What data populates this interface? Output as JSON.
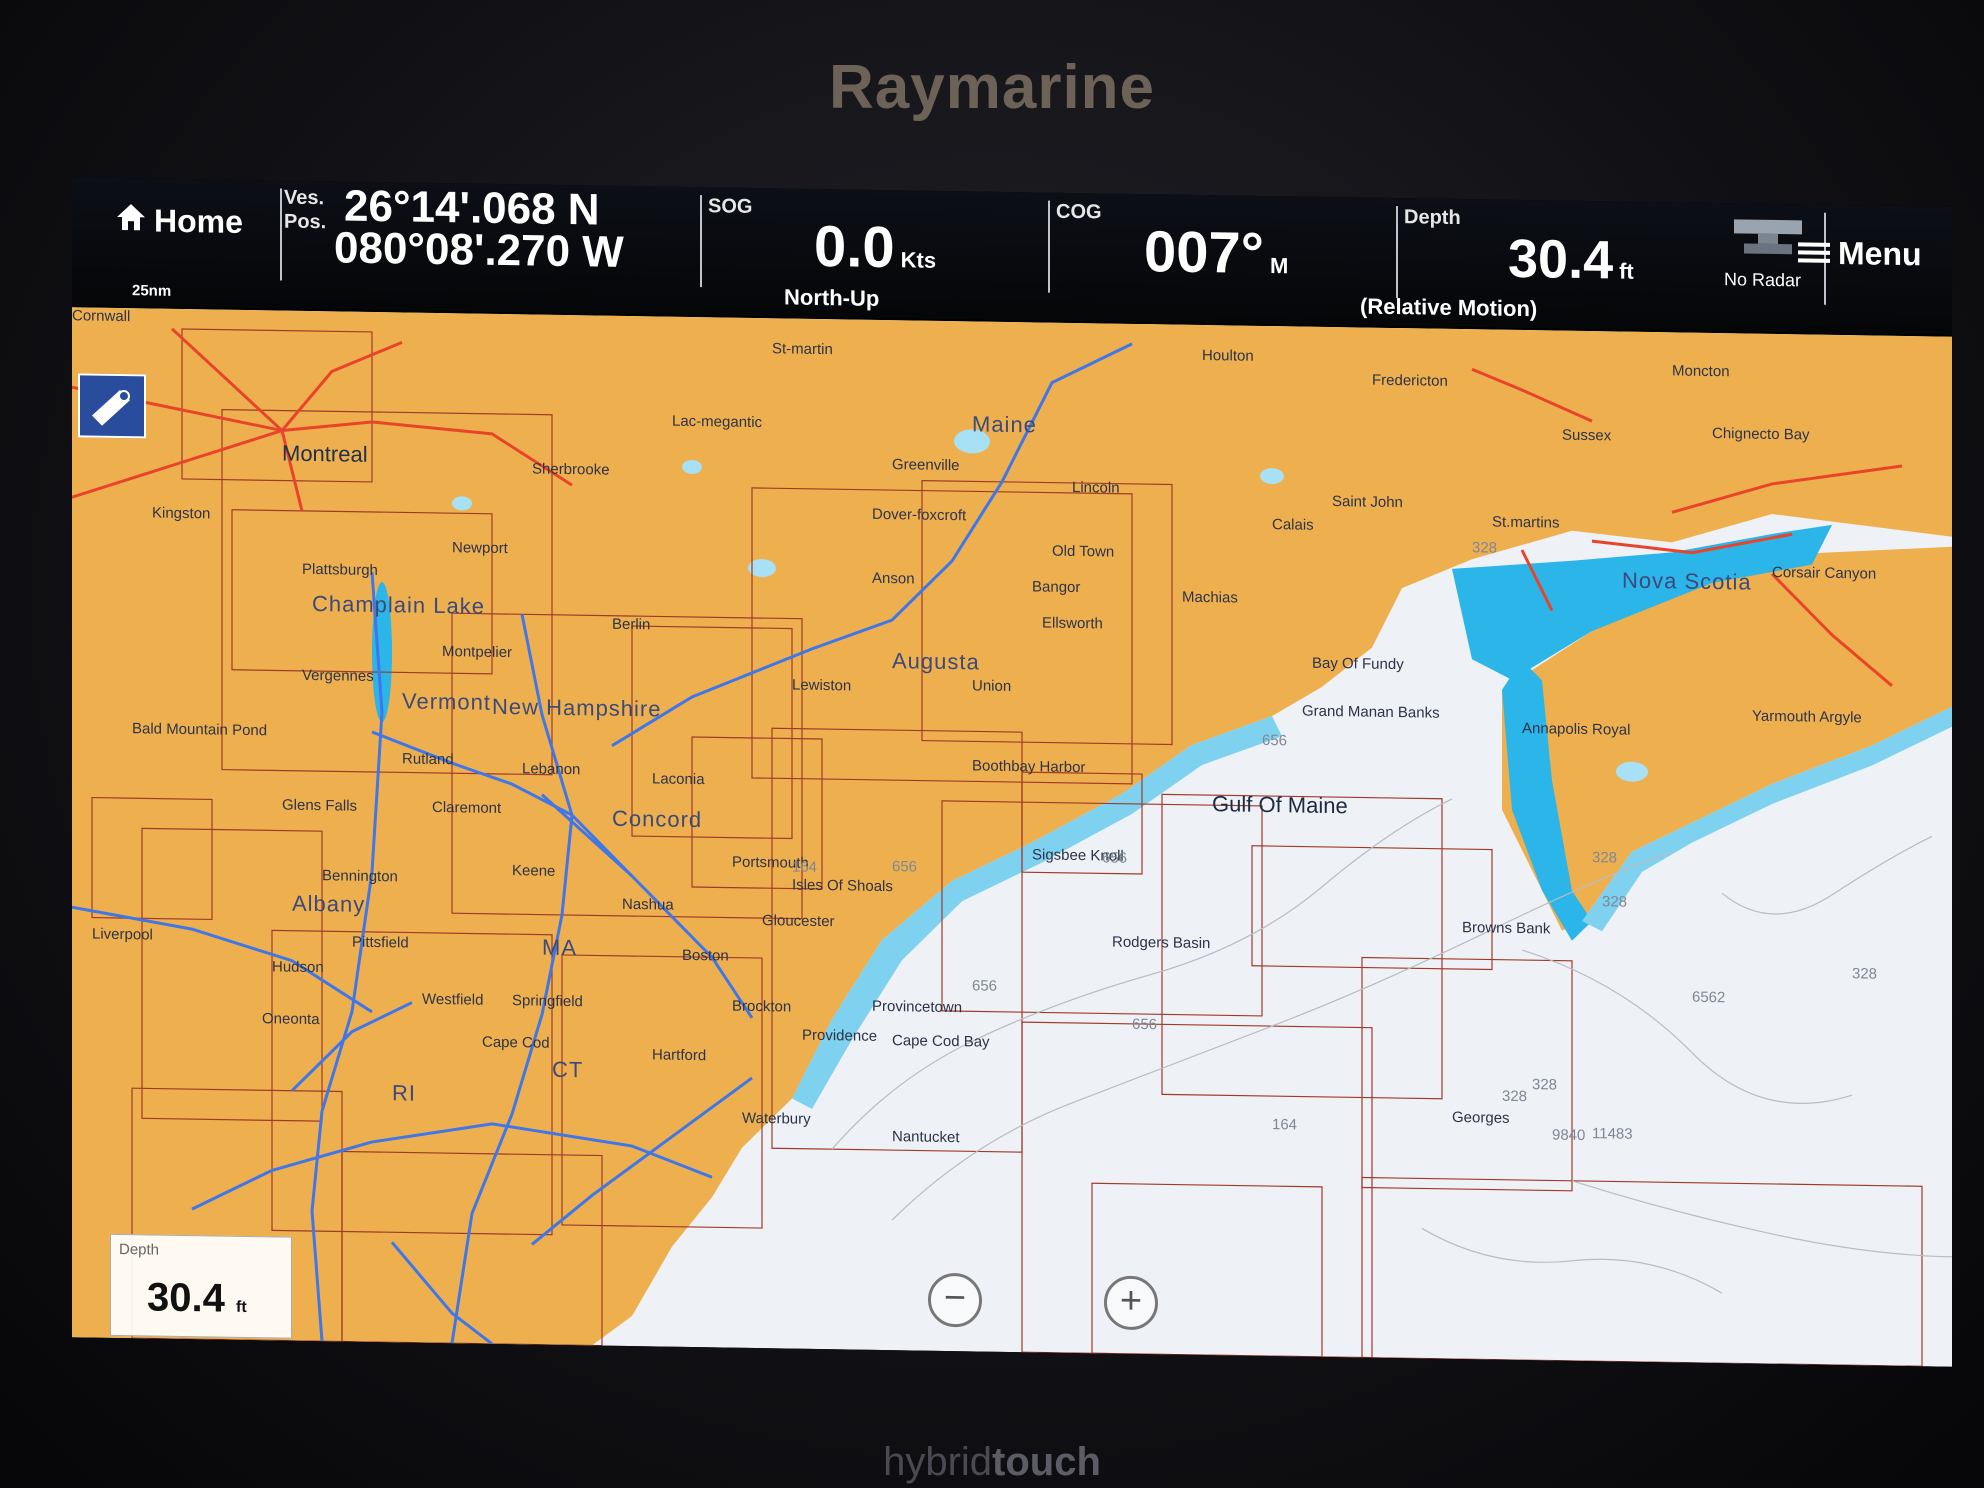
{
  "device": {
    "brand": "Raymarine",
    "bottom_brand_light": "hybrid",
    "bottom_brand_bold": "touch"
  },
  "databar": {
    "home_label": "Home",
    "ves_pos_label_1": "Ves.",
    "ves_pos_label_2": "Pos.",
    "latitude": "26°14'.068 N",
    "longitude": "080°08'.270 W",
    "sog_label": "SOG",
    "sog_value": "0.0",
    "sog_unit": "Kts",
    "orientation": "North-Up",
    "cog_label": "COG",
    "cog_value": "007°",
    "cog_unit": "M",
    "depth_label": "Depth",
    "depth_value": "30.4",
    "depth_unit": "ft",
    "motion_mode": "(Relative Motion)",
    "radar_label": "No Radar",
    "menu_label": "Menu",
    "scale": "25nm"
  },
  "map": {
    "labels": [
      {
        "text": "Montreal",
        "cls": "big1"
      },
      {
        "text": "Sherbrooke",
        "cls": ""
      },
      {
        "text": "Lac-megantic",
        "cls": ""
      },
      {
        "text": "St-martin",
        "cls": ""
      },
      {
        "text": "Houlton",
        "cls": ""
      },
      {
        "text": "Fredericton",
        "cls": ""
      },
      {
        "text": "Moncton",
        "cls": ""
      },
      {
        "text": "Sussex",
        "cls": ""
      },
      {
        "text": "Chignecto Bay",
        "cls": ""
      },
      {
        "text": "Maine",
        "cls": "state"
      },
      {
        "text": "Greenville",
        "cls": ""
      },
      {
        "text": "Lincoln",
        "cls": ""
      },
      {
        "text": "Saint John",
        "cls": ""
      },
      {
        "text": "St.martins",
        "cls": ""
      },
      {
        "text": "Dover-foxcroft",
        "cls": ""
      },
      {
        "text": "Old Town",
        "cls": ""
      },
      {
        "text": "Calais",
        "cls": ""
      },
      {
        "text": "Bangor",
        "cls": ""
      },
      {
        "text": "Anson",
        "cls": ""
      },
      {
        "text": "Machias",
        "cls": ""
      },
      {
        "text": "Ellsworth",
        "cls": ""
      },
      {
        "text": "Newport",
        "cls": ""
      },
      {
        "text": "Plattsburgh",
        "cls": ""
      },
      {
        "text": "Champlain Lake",
        "cls": "state"
      },
      {
        "text": "Berlin",
        "cls": ""
      },
      {
        "text": "Montpelier",
        "cls": ""
      },
      {
        "text": "Vergennes",
        "cls": ""
      },
      {
        "text": "Augusta",
        "cls": "state"
      },
      {
        "text": "Lewiston",
        "cls": ""
      },
      {
        "text": "Union",
        "cls": ""
      },
      {
        "text": "Bay Of Fundy",
        "cls": ""
      },
      {
        "text": "Grand Manan Banks",
        "cls": ""
      },
      {
        "text": "Vermont",
        "cls": "state"
      },
      {
        "text": "New Hampshire",
        "cls": "state"
      },
      {
        "text": "Bald Mountain Pond",
        "cls": ""
      },
      {
        "text": "Rutland",
        "cls": ""
      },
      {
        "text": "Lebanon",
        "cls": ""
      },
      {
        "text": "Laconia",
        "cls": ""
      },
      {
        "text": "Boothbay Harbor",
        "cls": ""
      },
      {
        "text": "Gulf Of Maine",
        "cls": "sea"
      },
      {
        "text": "Claremont",
        "cls": ""
      },
      {
        "text": "Glens Falls",
        "cls": ""
      },
      {
        "text": "Concord",
        "cls": "state"
      },
      {
        "text": "Bennington",
        "cls": ""
      },
      {
        "text": "Keene",
        "cls": ""
      },
      {
        "text": "Portsmouth",
        "cls": ""
      },
      {
        "text": "Isles Of Shoals",
        "cls": ""
      },
      {
        "text": "Sigsbee Knoll",
        "cls": ""
      },
      {
        "text": "Albany",
        "cls": "state"
      },
      {
        "text": "Nashua",
        "cls": ""
      },
      {
        "text": "Gloucester",
        "cls": ""
      },
      {
        "text": "Browns Bank",
        "cls": ""
      },
      {
        "text": "Pittsfield",
        "cls": ""
      },
      {
        "text": "MA",
        "cls": "state"
      },
      {
        "text": "Boston",
        "cls": ""
      },
      {
        "text": "Rodgers Basin",
        "cls": ""
      },
      {
        "text": "Hudson",
        "cls": ""
      },
      {
        "text": "Westfield",
        "cls": ""
      },
      {
        "text": "Springfield",
        "cls": ""
      },
      {
        "text": "Brockton",
        "cls": ""
      },
      {
        "text": "Provincetown",
        "cls": ""
      },
      {
        "text": "Providence",
        "cls": ""
      },
      {
        "text": "Cape Cod Bay",
        "cls": ""
      },
      {
        "text": "Cape Cod",
        "cls": ""
      },
      {
        "text": "CT",
        "cls": "state"
      },
      {
        "text": "Hartford",
        "cls": ""
      },
      {
        "text": "RI",
        "cls": "state"
      },
      {
        "text": "Waterbury",
        "cls": ""
      },
      {
        "text": "Nantucket",
        "cls": ""
      },
      {
        "text": "Georges",
        "cls": ""
      },
      {
        "text": "Corsair Canyon",
        "cls": ""
      },
      {
        "text": "Nova Scotia",
        "cls": "state"
      },
      {
        "text": "Annapolis Royal",
        "cls": ""
      },
      {
        "text": "Yarmouth Argyle",
        "cls": ""
      },
      {
        "text": "Liverpool",
        "cls": ""
      },
      {
        "text": "Oneonta",
        "cls": ""
      },
      {
        "text": "Kingston",
        "cls": ""
      },
      {
        "text": "Cornwall",
        "cls": ""
      }
    ],
    "depth_soundings": [
      "328",
      "656",
      "328",
      "656",
      "656",
      "164",
      "328",
      "328",
      "328",
      "656",
      "656",
      "164",
      "9840",
      "11483",
      "6562",
      "328"
    ]
  },
  "depth_overlay": {
    "label": "Depth",
    "value": "30.4",
    "unit": "ft"
  },
  "colors": {
    "land": "#eeb04f",
    "water": "#eef1f5",
    "shallow": "#2cb5e8",
    "roads": "#e8442a",
    "rivers": "#3f76e8",
    "chart_grid": "#a03a2a"
  }
}
